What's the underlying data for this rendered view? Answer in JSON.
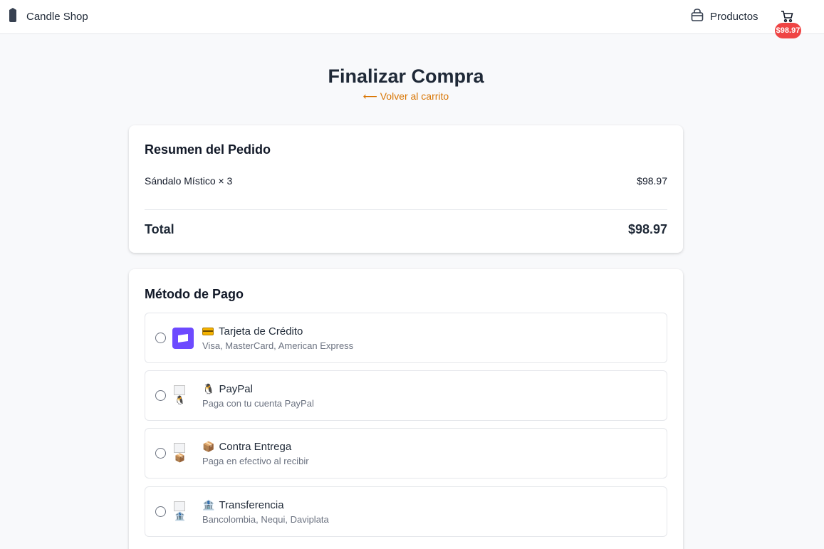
{
  "header": {
    "brand": "Candle Shop",
    "nav_products": "Productos",
    "cart_badge": "$98.97"
  },
  "page": {
    "title": "Finalizar Compra",
    "back_link": "⟵ Volver al carrito"
  },
  "summary": {
    "heading": "Resumen del Pedido",
    "items": [
      {
        "label": "Sándalo Místico × 3",
        "price": "$98.97"
      }
    ],
    "total_label": "Total",
    "total_value": "$98.97"
  },
  "payment": {
    "heading": "Método de Pago",
    "options": [
      {
        "title": "Tarjeta de Crédito",
        "subtitle": "Visa, MasterCard, American Express",
        "icon": "credit-card-icon",
        "emoji": "💳"
      },
      {
        "title": "PayPal",
        "subtitle": "Paga con tu cuenta PayPal",
        "icon": "penguin-icon",
        "emoji": "🐧"
      },
      {
        "title": "Contra Entrega",
        "subtitle": "Paga en efectivo al recibir",
        "icon": "package-icon",
        "emoji": "📦"
      },
      {
        "title": "Transferencia",
        "subtitle": "Bancolombia, Nequi, Daviplata",
        "icon": "bank-icon",
        "emoji": "🏦"
      }
    ]
  },
  "colors": {
    "accent": "#d97706",
    "badge": "#ef4444",
    "card_logo": "#6d4aff"
  }
}
